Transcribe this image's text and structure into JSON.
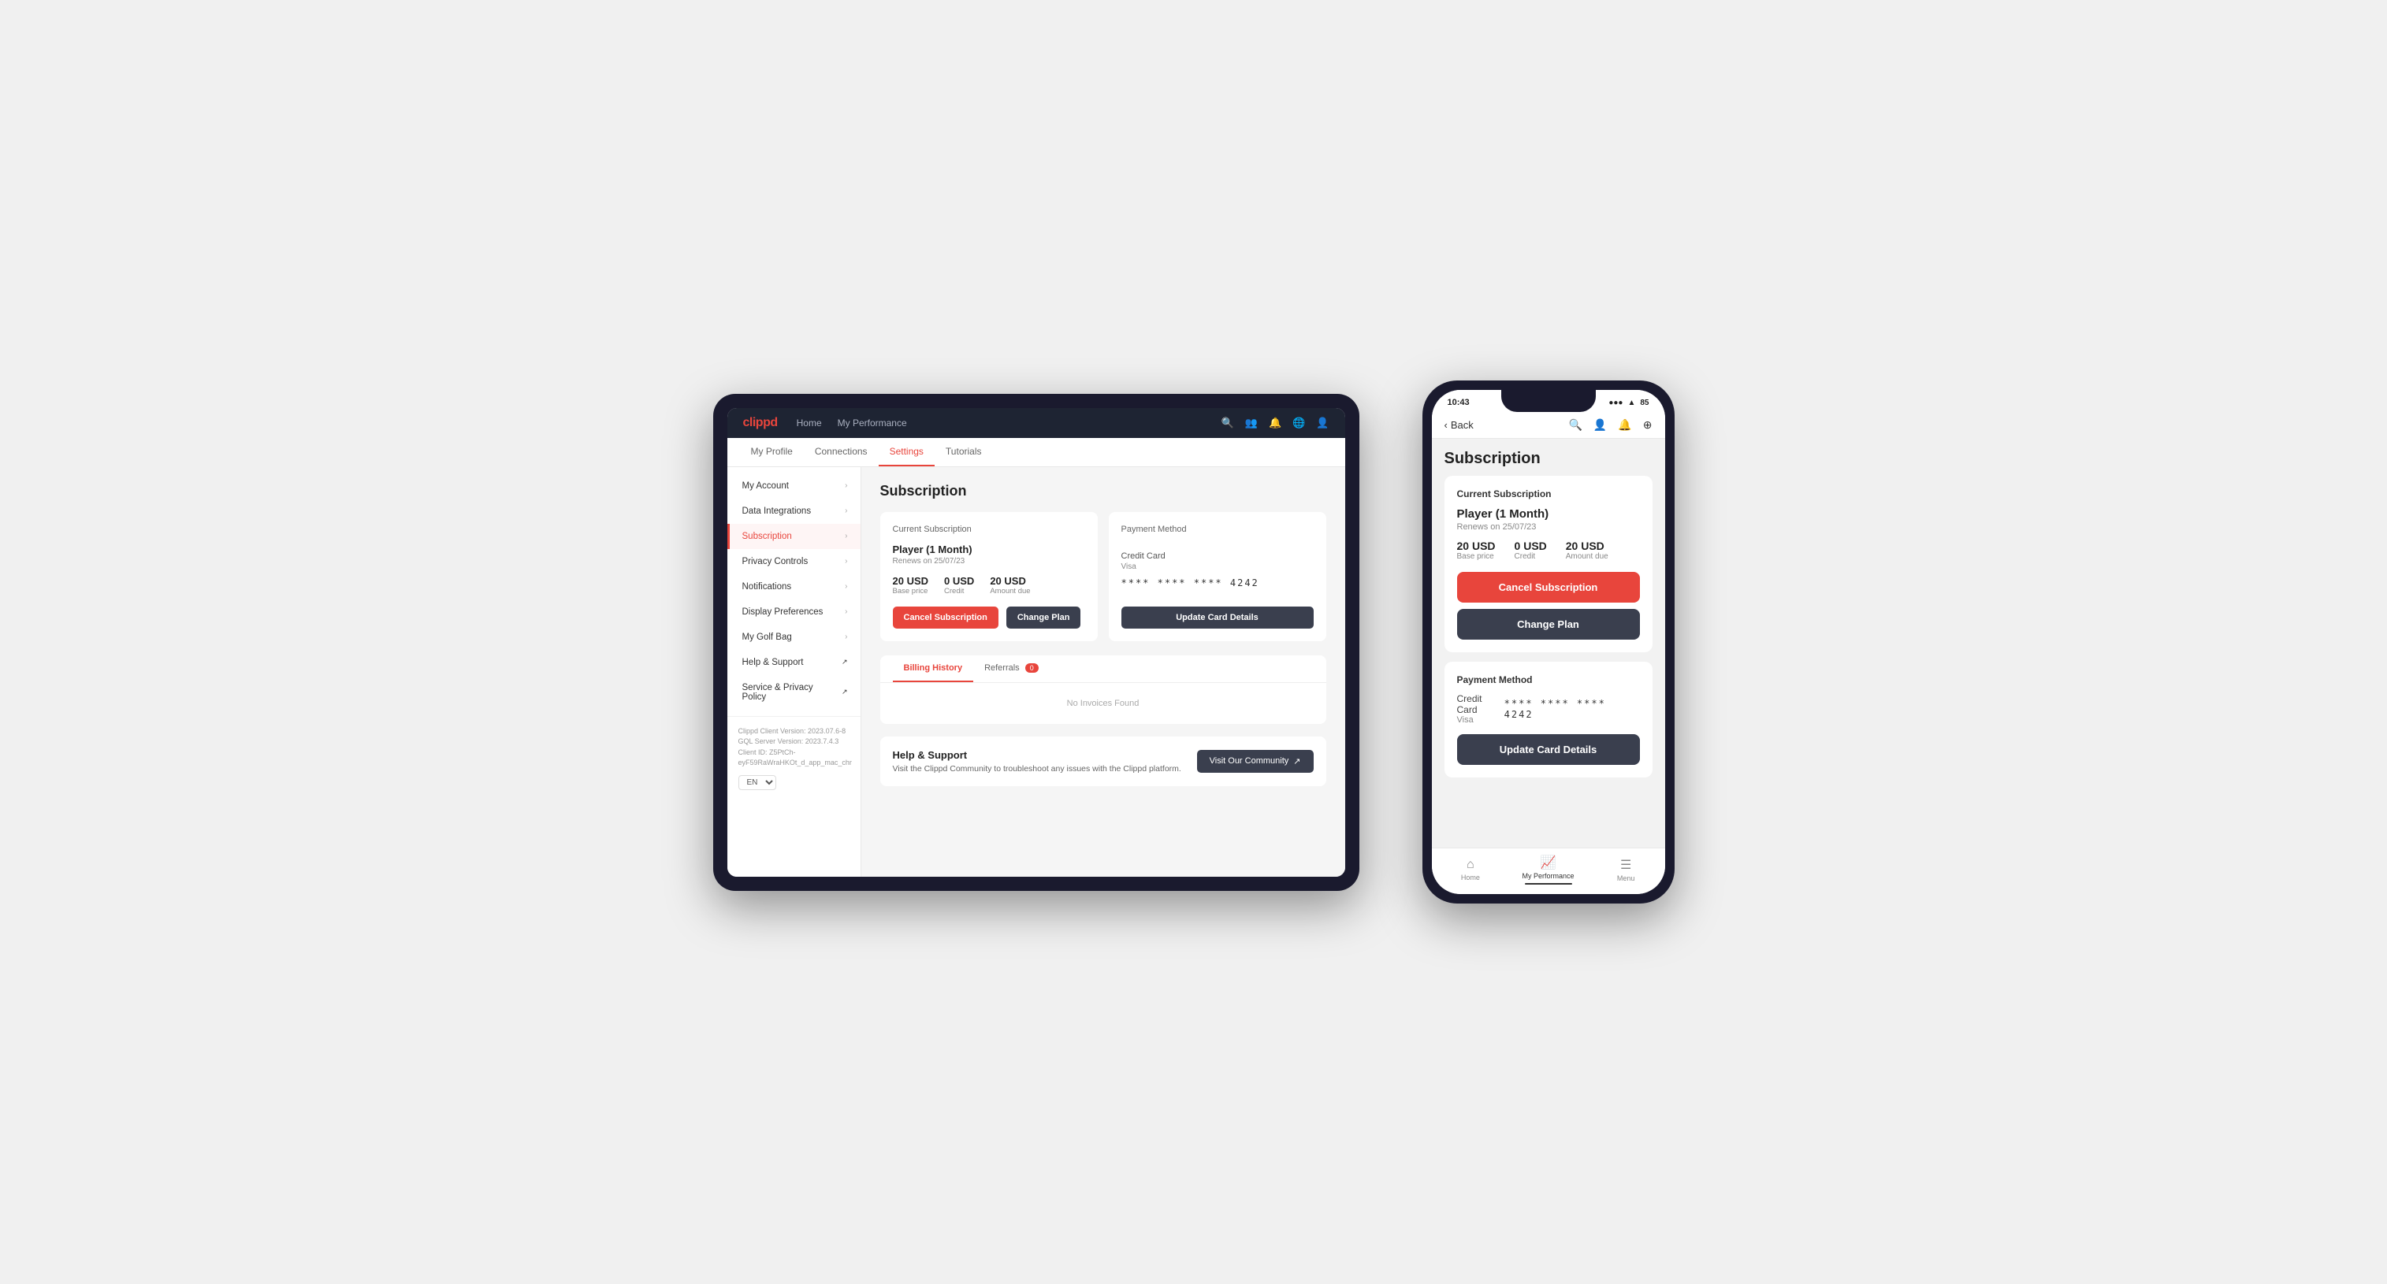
{
  "app": {
    "logo": "clippd",
    "nav": [
      "Home",
      "My Performance"
    ],
    "tabs": [
      "My Profile",
      "Connections",
      "Settings",
      "Tutorials"
    ]
  },
  "sidebar": {
    "items": [
      {
        "label": "My Account",
        "active": false
      },
      {
        "label": "Data Integrations",
        "active": false
      },
      {
        "label": "Subscription",
        "active": true
      },
      {
        "label": "Privacy Controls",
        "active": false
      },
      {
        "label": "Notifications",
        "active": false
      },
      {
        "label": "Display Preferences",
        "active": false
      },
      {
        "label": "My Golf Bag",
        "active": false
      },
      {
        "label": "Help & Support",
        "active": false,
        "external": true
      },
      {
        "label": "Service & Privacy Policy",
        "active": false,
        "external": true
      }
    ],
    "footer": {
      "line1": "Clippd Client Version: 2023.07.6-8",
      "line2": "GQL Server Version: 2023.7.4.3",
      "line3": "Client ID: Z5PtCh-eyF59RaWraHKOt_d_app_mac_chr"
    },
    "language": "EN"
  },
  "subscription": {
    "page_title": "Subscription",
    "current_card": {
      "title": "Current Subscription",
      "plan_name": "Player (1 Month)",
      "renews": "Renews on 25/07/23",
      "base_price": "20 USD",
      "base_price_label": "Base price",
      "credit": "0 USD",
      "credit_label": "Credit",
      "amount_due": "20 USD",
      "amount_due_label": "Amount due",
      "cancel_btn": "Cancel Subscription",
      "change_btn": "Change Plan"
    },
    "payment_card": {
      "title": "Payment Method",
      "type": "Credit Card",
      "brand": "Visa",
      "masked_number": "**** **** **** 4242",
      "update_btn": "Update Card Details"
    },
    "billing": {
      "tab_billing": "Billing History",
      "tab_referrals": "Referrals",
      "referrals_count": "0",
      "empty_message": "No Invoices Found"
    },
    "help": {
      "title": "Help & Support",
      "description": "Visit the Clippd Community to troubleshoot any issues with the Clippd platform.",
      "community_btn": "Visit Our Community"
    }
  },
  "phone": {
    "status": {
      "time": "10:43",
      "signal": "●●●",
      "wifi": "WiFi",
      "battery": "85"
    },
    "back_label": "Back",
    "nav_icons": [
      "search",
      "person",
      "bell",
      "add"
    ],
    "page_title": "Subscription",
    "current_card": {
      "title": "Current Subscription",
      "plan_name": "Player (1 Month)",
      "renews": "Renews on 25/07/23",
      "base_price": "20 USD",
      "base_price_label": "Base price",
      "credit": "0 USD",
      "credit_label": "Credit",
      "amount_due": "20 USD",
      "amount_due_label": "Amount due",
      "cancel_btn": "Cancel Subscription",
      "change_btn": "Change Plan"
    },
    "payment_card": {
      "title": "Payment Method",
      "type": "Credit Card",
      "brand": "Visa",
      "masked_number": "**** **** **** 4242",
      "update_btn": "Update Card Details"
    },
    "bottom_nav": [
      {
        "label": "Home",
        "icon": "⌂",
        "active": false
      },
      {
        "label": "My Performance",
        "icon": "📈",
        "active": true
      },
      {
        "label": "Menu",
        "icon": "☰",
        "active": false
      }
    ]
  }
}
